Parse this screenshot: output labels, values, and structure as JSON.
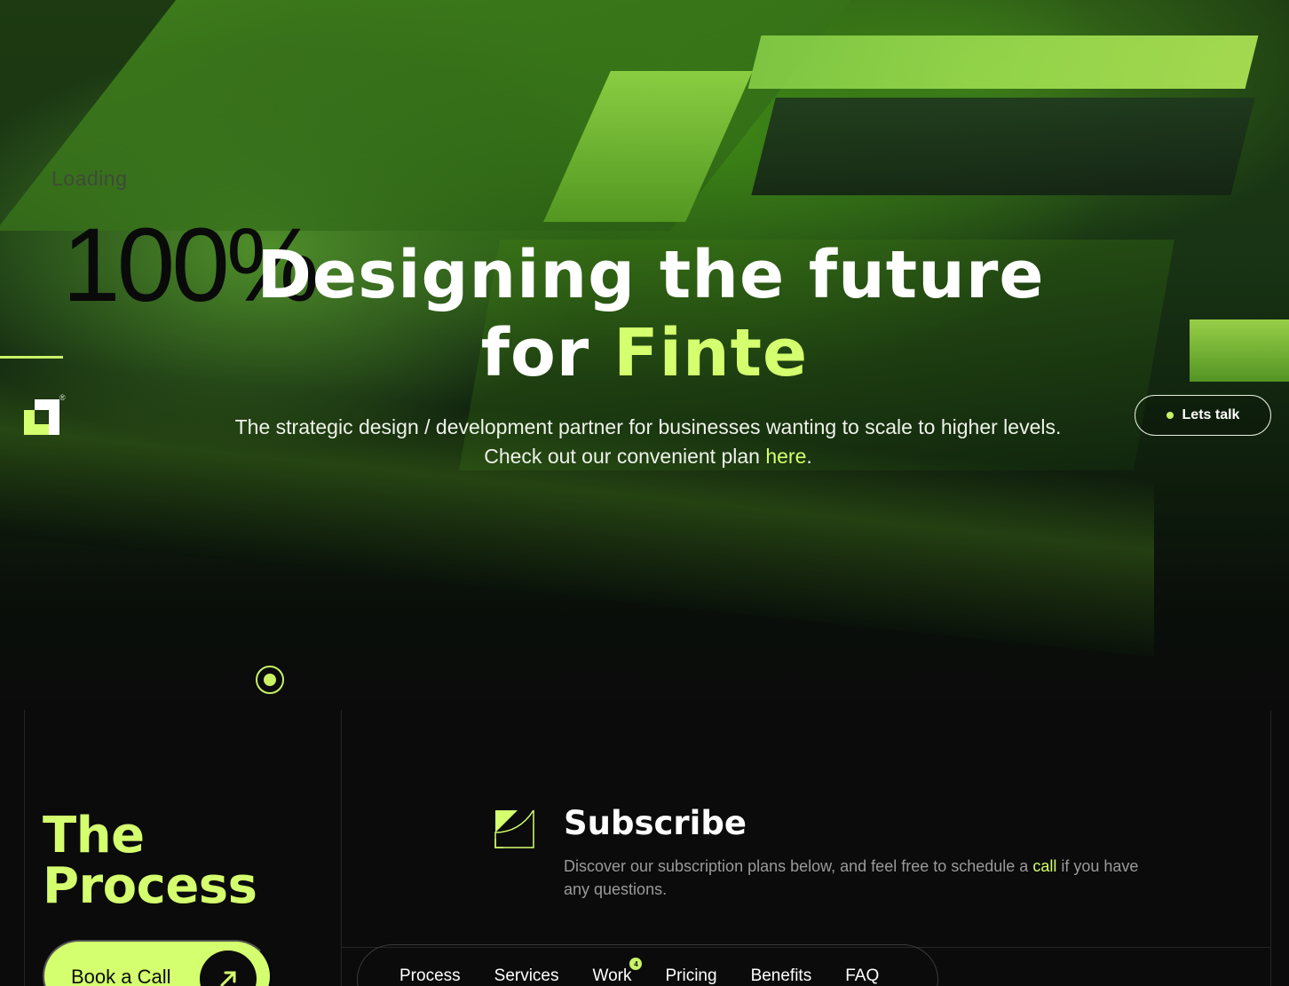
{
  "hero": {
    "loading_label": "Loading",
    "loading_percent": "100%",
    "title_line1": "Designing the future",
    "title_line2_prefix": "for",
    "title_line2_accent": "Finte",
    "subtitle_text": "The strategic design / development partner for businesses wanting to scale to higher levels. Check out our convenient plan",
    "subtitle_link": "here",
    "subtitle_end": ".",
    "lets_talk_label": "Lets talk",
    "brand_reg": "®"
  },
  "process": {
    "title_line1": "The",
    "title_line2": "Process",
    "book_call_label": "Book a Call"
  },
  "subscribe": {
    "title": "Subscribe",
    "desc_before": "Discover our subscription plans below, and feel free to schedule a",
    "desc_link": "call",
    "desc_after": "if you have any questions."
  },
  "nav": {
    "tabs": [
      {
        "label": "Process"
      },
      {
        "label": "Services"
      },
      {
        "label": "Work",
        "badge": "4"
      },
      {
        "label": "Pricing"
      },
      {
        "label": "Benefits"
      },
      {
        "label": "FAQ"
      }
    ]
  },
  "colors": {
    "accent": "#d4ff6e",
    "background": "#0b0b0b"
  },
  "icons": [
    "brand-logo-icon",
    "arrow-up-right-icon",
    "subscribe-icon",
    "scroll-indicator-icon"
  ]
}
